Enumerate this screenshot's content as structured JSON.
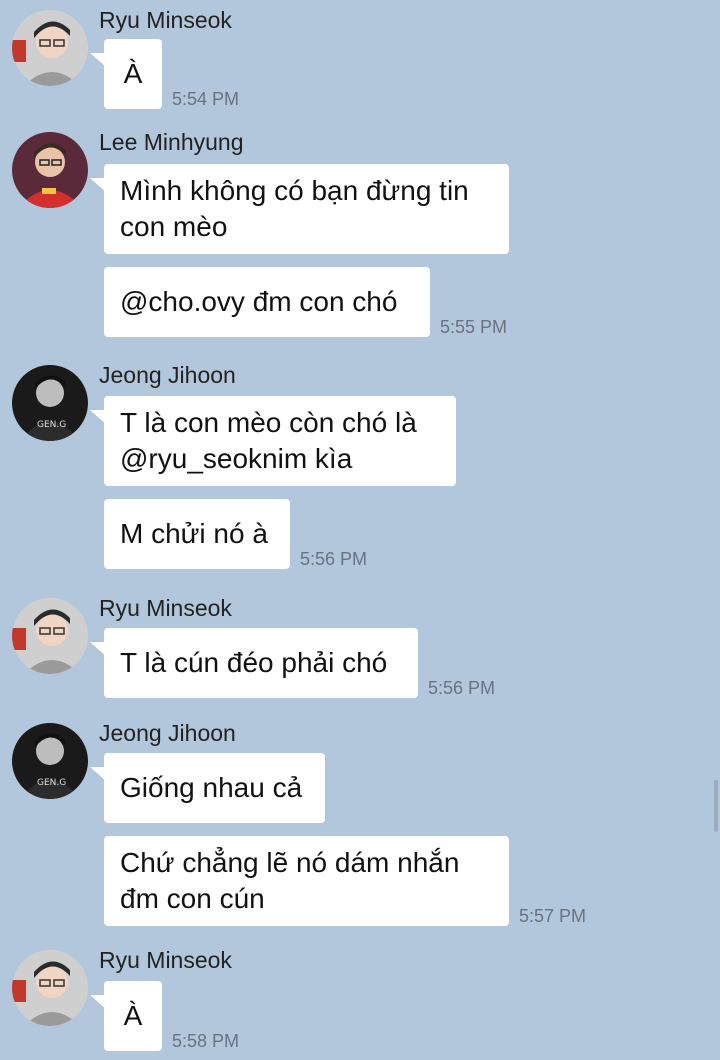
{
  "messages_groups": [
    {
      "sender": "Ryu Minseok",
      "avatar": "avatar-ryu-minseok",
      "messages": [
        {
          "text": "À",
          "time": "5:54 PM"
        }
      ]
    },
    {
      "sender": "Lee Minhyung",
      "avatar": "avatar-lee-minhyung",
      "messages": [
        {
          "text": "Mình không có bạn đừng tin\ncon mèo",
          "time": ""
        },
        {
          "text": "@cho.ovy đm con chó",
          "time": "5:55 PM"
        }
      ]
    },
    {
      "sender": "Jeong Jihoon",
      "avatar": "avatar-jeong-jihoon",
      "messages": [
        {
          "text": "T là con mèo còn chó là\n@ryu_seoknim kìa",
          "time": ""
        },
        {
          "text": "M chửi nó à",
          "time": "5:56 PM"
        }
      ]
    },
    {
      "sender": "Ryu Minseok",
      "avatar": "avatar-ryu-minseok",
      "messages": [
        {
          "text": "T là cún đéo phải chó",
          "time": "5:56 PM"
        }
      ]
    },
    {
      "sender": "Jeong Jihoon",
      "avatar": "avatar-jeong-jihoon",
      "messages": [
        {
          "text": "Giống nhau cả",
          "time": ""
        },
        {
          "text": "Chứ chẳng lẽ nó dám nhắn\nđm con cún",
          "time": "5:57 PM"
        }
      ]
    },
    {
      "sender": "Ryu Minseok",
      "avatar": "avatar-ryu-minseok",
      "messages": [
        {
          "text": "À",
          "time": "5:58 PM"
        }
      ]
    }
  ],
  "colors": {
    "background": "#b2c7db",
    "bubble": "#ffffff",
    "time": "#6b7280"
  }
}
